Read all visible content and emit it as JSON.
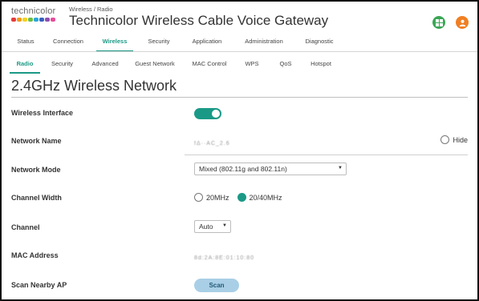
{
  "header": {
    "logo_text": "technicolor",
    "breadcrumb": "Wireless / Radio",
    "title": "Technicolor Wireless Cable Voice Gateway",
    "logo_colors": [
      "#e63b3b",
      "#f39a1e",
      "#f4d21f",
      "#6cbd45",
      "#2aa6dd",
      "#3b5fbf",
      "#8c4fb0",
      "#e64d9a"
    ],
    "grid_icon": "apps-grid-icon",
    "user_icon": "user-icon",
    "grid_color": "#3aa655",
    "user_color": "#f07f23"
  },
  "main_nav": {
    "tabs": [
      {
        "label": "Status"
      },
      {
        "label": "Connection"
      },
      {
        "label": "Wireless",
        "active": true
      },
      {
        "label": "Security"
      },
      {
        "label": "Application"
      },
      {
        "label": "Administration"
      },
      {
        "label": "Diagnostic"
      }
    ]
  },
  "sub_nav": {
    "tabs": [
      {
        "label": "Radio",
        "active": true
      },
      {
        "label": "Security"
      },
      {
        "label": "Advanced"
      },
      {
        "label": "Guest Network"
      },
      {
        "label": "MAC Control"
      },
      {
        "label": "WPS"
      },
      {
        "label": "QoS"
      },
      {
        "label": "Hotspot"
      }
    ]
  },
  "page": {
    "title": "2.4GHz Wireless Network"
  },
  "form": {
    "wireless_interface": {
      "label": "Wireless Interface",
      "enabled": true
    },
    "network_name": {
      "label": "Network Name",
      "value": "fΔ··AC_2.6",
      "hide_label": "Hide",
      "hide_checked": false
    },
    "network_mode": {
      "label": "Network Mode",
      "value": "Mixed (802.11g and 802.11n)"
    },
    "channel_width": {
      "label": "Channel Width",
      "option_20": "20MHz",
      "option_2040": "20/40MHz",
      "selected": "20/40MHz"
    },
    "channel": {
      "label": "Channel",
      "value": "Auto"
    },
    "mac_address": {
      "label": "MAC Address",
      "value": "8d:2A:8E:01:10:80"
    },
    "scan": {
      "label": "Scan Nearby AP",
      "button": "Scan"
    }
  },
  "accent_color": "#1a9a86"
}
